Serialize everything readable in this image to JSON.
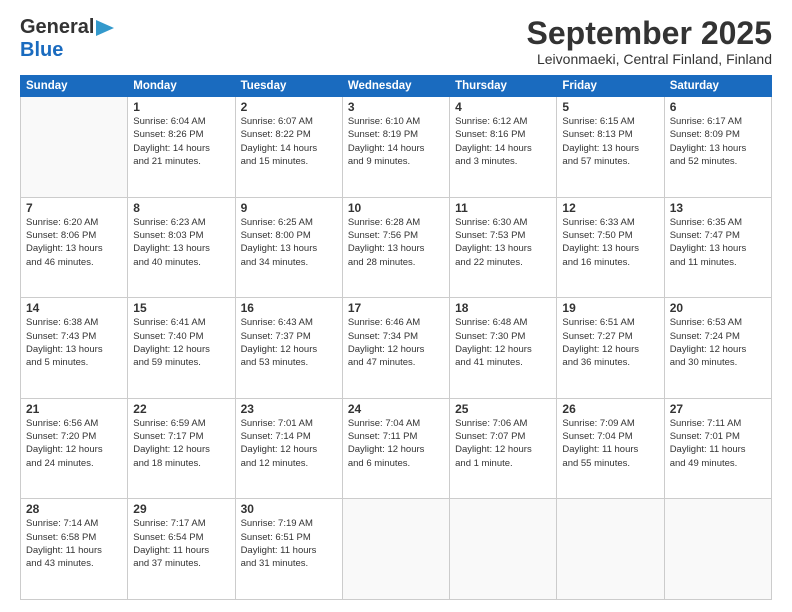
{
  "logo": {
    "line1": "General",
    "line2": "Blue",
    "arrow": "▶"
  },
  "title": "September 2025",
  "subtitle": "Leivonmaeki, Central Finland, Finland",
  "days_header": [
    "Sunday",
    "Monday",
    "Tuesday",
    "Wednesday",
    "Thursday",
    "Friday",
    "Saturday"
  ],
  "weeks": [
    [
      {
        "num": "",
        "detail": ""
      },
      {
        "num": "1",
        "detail": "Sunrise: 6:04 AM\nSunset: 8:26 PM\nDaylight: 14 hours\nand 21 minutes."
      },
      {
        "num": "2",
        "detail": "Sunrise: 6:07 AM\nSunset: 8:22 PM\nDaylight: 14 hours\nand 15 minutes."
      },
      {
        "num": "3",
        "detail": "Sunrise: 6:10 AM\nSunset: 8:19 PM\nDaylight: 14 hours\nand 9 minutes."
      },
      {
        "num": "4",
        "detail": "Sunrise: 6:12 AM\nSunset: 8:16 PM\nDaylight: 14 hours\nand 3 minutes."
      },
      {
        "num": "5",
        "detail": "Sunrise: 6:15 AM\nSunset: 8:13 PM\nDaylight: 13 hours\nand 57 minutes."
      },
      {
        "num": "6",
        "detail": "Sunrise: 6:17 AM\nSunset: 8:09 PM\nDaylight: 13 hours\nand 52 minutes."
      }
    ],
    [
      {
        "num": "7",
        "detail": "Sunrise: 6:20 AM\nSunset: 8:06 PM\nDaylight: 13 hours\nand 46 minutes."
      },
      {
        "num": "8",
        "detail": "Sunrise: 6:23 AM\nSunset: 8:03 PM\nDaylight: 13 hours\nand 40 minutes."
      },
      {
        "num": "9",
        "detail": "Sunrise: 6:25 AM\nSunset: 8:00 PM\nDaylight: 13 hours\nand 34 minutes."
      },
      {
        "num": "10",
        "detail": "Sunrise: 6:28 AM\nSunset: 7:56 PM\nDaylight: 13 hours\nand 28 minutes."
      },
      {
        "num": "11",
        "detail": "Sunrise: 6:30 AM\nSunset: 7:53 PM\nDaylight: 13 hours\nand 22 minutes."
      },
      {
        "num": "12",
        "detail": "Sunrise: 6:33 AM\nSunset: 7:50 PM\nDaylight: 13 hours\nand 16 minutes."
      },
      {
        "num": "13",
        "detail": "Sunrise: 6:35 AM\nSunset: 7:47 PM\nDaylight: 13 hours\nand 11 minutes."
      }
    ],
    [
      {
        "num": "14",
        "detail": "Sunrise: 6:38 AM\nSunset: 7:43 PM\nDaylight: 13 hours\nand 5 minutes."
      },
      {
        "num": "15",
        "detail": "Sunrise: 6:41 AM\nSunset: 7:40 PM\nDaylight: 12 hours\nand 59 minutes."
      },
      {
        "num": "16",
        "detail": "Sunrise: 6:43 AM\nSunset: 7:37 PM\nDaylight: 12 hours\nand 53 minutes."
      },
      {
        "num": "17",
        "detail": "Sunrise: 6:46 AM\nSunset: 7:34 PM\nDaylight: 12 hours\nand 47 minutes."
      },
      {
        "num": "18",
        "detail": "Sunrise: 6:48 AM\nSunset: 7:30 PM\nDaylight: 12 hours\nand 41 minutes."
      },
      {
        "num": "19",
        "detail": "Sunrise: 6:51 AM\nSunset: 7:27 PM\nDaylight: 12 hours\nand 36 minutes."
      },
      {
        "num": "20",
        "detail": "Sunrise: 6:53 AM\nSunset: 7:24 PM\nDaylight: 12 hours\nand 30 minutes."
      }
    ],
    [
      {
        "num": "21",
        "detail": "Sunrise: 6:56 AM\nSunset: 7:20 PM\nDaylight: 12 hours\nand 24 minutes."
      },
      {
        "num": "22",
        "detail": "Sunrise: 6:59 AM\nSunset: 7:17 PM\nDaylight: 12 hours\nand 18 minutes."
      },
      {
        "num": "23",
        "detail": "Sunrise: 7:01 AM\nSunset: 7:14 PM\nDaylight: 12 hours\nand 12 minutes."
      },
      {
        "num": "24",
        "detail": "Sunrise: 7:04 AM\nSunset: 7:11 PM\nDaylight: 12 hours\nand 6 minutes."
      },
      {
        "num": "25",
        "detail": "Sunrise: 7:06 AM\nSunset: 7:07 PM\nDaylight: 12 hours\nand 1 minute."
      },
      {
        "num": "26",
        "detail": "Sunrise: 7:09 AM\nSunset: 7:04 PM\nDaylight: 11 hours\nand 55 minutes."
      },
      {
        "num": "27",
        "detail": "Sunrise: 7:11 AM\nSunset: 7:01 PM\nDaylight: 11 hours\nand 49 minutes."
      }
    ],
    [
      {
        "num": "28",
        "detail": "Sunrise: 7:14 AM\nSunset: 6:58 PM\nDaylight: 11 hours\nand 43 minutes."
      },
      {
        "num": "29",
        "detail": "Sunrise: 7:17 AM\nSunset: 6:54 PM\nDaylight: 11 hours\nand 37 minutes."
      },
      {
        "num": "30",
        "detail": "Sunrise: 7:19 AM\nSunset: 6:51 PM\nDaylight: 11 hours\nand 31 minutes."
      },
      {
        "num": "",
        "detail": ""
      },
      {
        "num": "",
        "detail": ""
      },
      {
        "num": "",
        "detail": ""
      },
      {
        "num": "",
        "detail": ""
      }
    ]
  ]
}
